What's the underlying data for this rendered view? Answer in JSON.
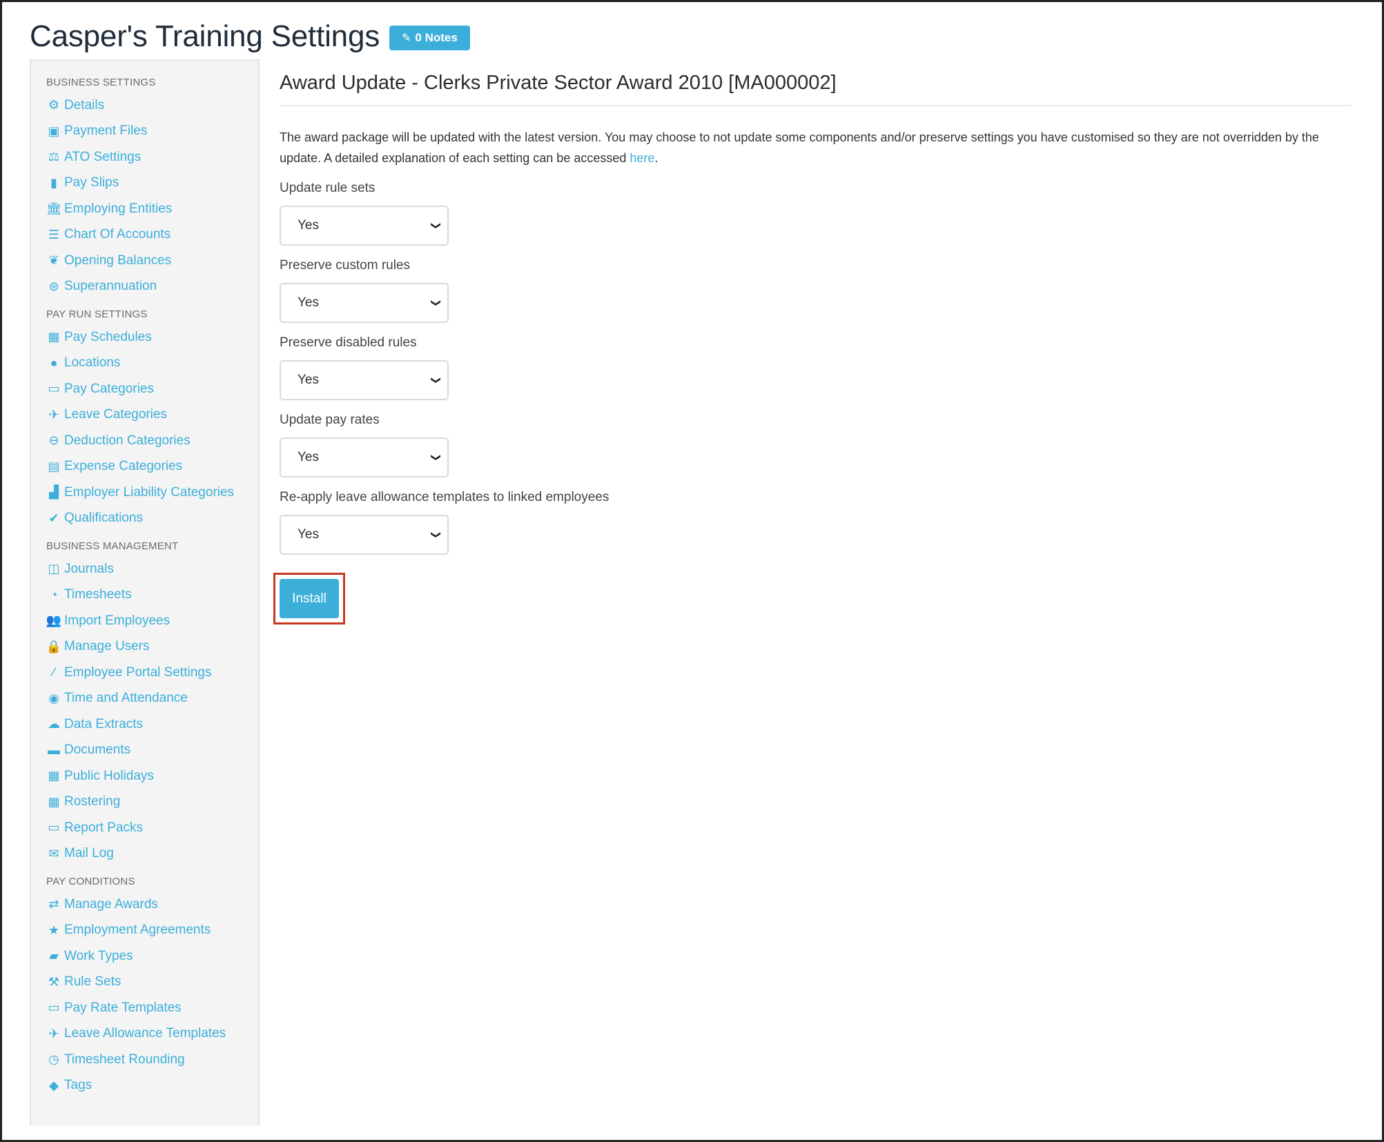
{
  "page": {
    "title": "Casper's Training Settings",
    "notes_label": "0 Notes"
  },
  "sidebar": {
    "sections": [
      {
        "title": "BUSINESS SETTINGS",
        "items": [
          {
            "label": "Details",
            "icon": "gear-icon"
          },
          {
            "label": "Payment Files",
            "icon": "floppy-icon"
          },
          {
            "label": "ATO Settings",
            "icon": "balance-scale-icon"
          },
          {
            "label": "Pay Slips",
            "icon": "file-icon"
          },
          {
            "label": "Employing Entities",
            "icon": "bank-icon"
          },
          {
            "label": "Chart Of Accounts",
            "icon": "list-icon"
          },
          {
            "label": "Opening Balances",
            "icon": "leaf-icon"
          },
          {
            "label": "Superannuation",
            "icon": "life-ring-icon"
          }
        ]
      },
      {
        "title": "PAY RUN SETTINGS",
        "items": [
          {
            "label": "Pay Schedules",
            "icon": "calendar-icon"
          },
          {
            "label": "Locations",
            "icon": "globe-icon"
          },
          {
            "label": "Pay Categories",
            "icon": "money-icon"
          },
          {
            "label": "Leave Categories",
            "icon": "plane-icon"
          },
          {
            "label": "Deduction Categories",
            "icon": "minus-circle-icon"
          },
          {
            "label": "Expense Categories",
            "icon": "archive-icon"
          },
          {
            "label": "Employer Liability Categories",
            "icon": "industry-icon"
          },
          {
            "label": "Qualifications",
            "icon": "check-icon"
          }
        ]
      },
      {
        "title": "BUSINESS MANAGEMENT",
        "items": [
          {
            "label": "Journals",
            "icon": "columns-icon"
          },
          {
            "label": "Timesheets",
            "icon": "clock-icon"
          },
          {
            "label": "Import Employees",
            "icon": "users-icon"
          },
          {
            "label": "Manage Users",
            "icon": "lock-icon"
          },
          {
            "label": "Employee Portal Settings",
            "icon": "magic-wand-icon"
          },
          {
            "label": "Time and Attendance",
            "icon": "user-circle-icon"
          },
          {
            "label": "Data Extracts",
            "icon": "cloud-download-icon"
          },
          {
            "label": "Documents",
            "icon": "folder-icon"
          },
          {
            "label": "Public Holidays",
            "icon": "calendar-icon"
          },
          {
            "label": "Rostering",
            "icon": "calendar-grid-icon"
          },
          {
            "label": "Report Packs",
            "icon": "folder-open-icon"
          },
          {
            "label": "Mail Log",
            "icon": "envelope-icon"
          }
        ]
      },
      {
        "title": "PAY CONDITIONS",
        "items": [
          {
            "label": "Manage Awards",
            "icon": "exchange-icon"
          },
          {
            "label": "Employment Agreements",
            "icon": "star-icon"
          },
          {
            "label": "Work Types",
            "icon": "book-icon"
          },
          {
            "label": "Rule Sets",
            "icon": "gavel-icon"
          },
          {
            "label": "Pay Rate Templates",
            "icon": "money-icon"
          },
          {
            "label": "Leave Allowance Templates",
            "icon": "plane-icon"
          },
          {
            "label": "Timesheet Rounding",
            "icon": "clock-icon"
          },
          {
            "label": "Tags",
            "icon": "tag-icon"
          }
        ]
      }
    ]
  },
  "main": {
    "award_title": "Award Update - Clerks Private Sector Award 2010 [MA000002]",
    "intro_text": "The award package will be updated with the latest version. You may choose to not update some components and/or preserve settings you have customised so they are not overridden by the update. A detailed explanation of each setting can be accessed ",
    "intro_link": "here",
    "intro_end": ".",
    "fields": [
      {
        "label": "Update rule sets",
        "value": "Yes"
      },
      {
        "label": "Preserve custom rules",
        "value": "Yes"
      },
      {
        "label": "Preserve disabled rules",
        "value": "Yes"
      },
      {
        "label": "Update pay rates",
        "value": "Yes"
      },
      {
        "label": "Re-apply leave allowance templates to linked employees",
        "value": "Yes"
      }
    ],
    "install_label": "Install"
  },
  "colors": {
    "accent": "#3bafda",
    "highlight_border": "#c8381f",
    "title_text": "#1f2d3a"
  }
}
